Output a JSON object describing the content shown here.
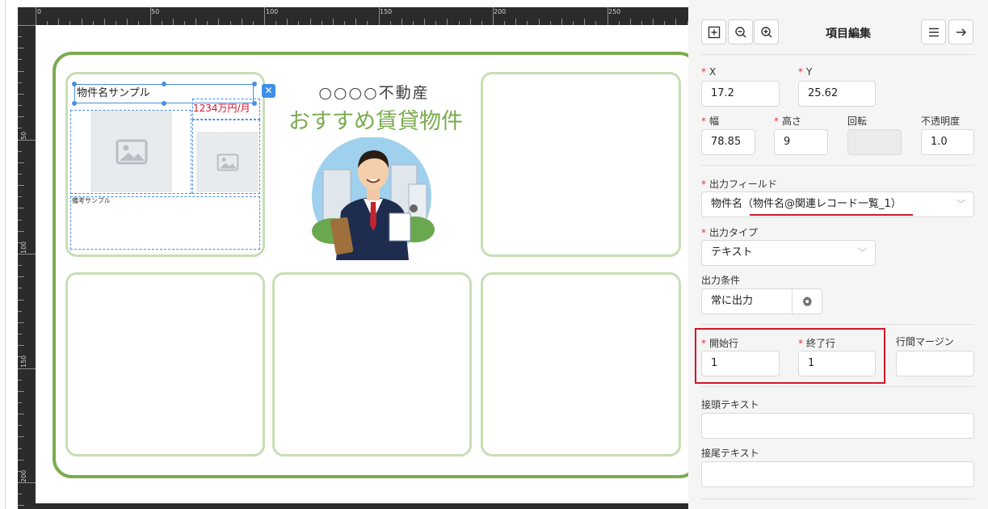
{
  "ruler": {
    "top_labels": [
      "0",
      "50",
      "100",
      "150",
      "200",
      "250"
    ],
    "left_labels": [
      "50",
      "100",
      "150",
      "200"
    ]
  },
  "canvas": {
    "selected_name_text": "物件名サンプル",
    "price_text": "1234万円/月",
    "remarks_text": "備考サンプル",
    "shop_name": "○○○○不動産",
    "heading": "おすすめ賃貸物件",
    "close_icon": "close-icon"
  },
  "panel": {
    "title": "項目編集",
    "icons": {
      "add": "add-frame-icon",
      "zoom_out": "zoom-out-icon",
      "zoom_in": "zoom-in-icon",
      "menu": "menu-icon",
      "forward": "arrow-right-icon",
      "settings": "gear-icon",
      "dropdown": "chevron-down-icon"
    },
    "x": {
      "label": "X",
      "value": "17.2"
    },
    "y": {
      "label": "Y",
      "value": "25.62"
    },
    "width": {
      "label": "幅",
      "value": "78.85"
    },
    "height": {
      "label": "高さ",
      "value": "9"
    },
    "rotation": {
      "label": "回転",
      "value": ""
    },
    "opacity": {
      "label": "不透明度",
      "value": "1.0"
    },
    "output_field": {
      "label": "出力フィールド",
      "value": "物件名（物件名@関連レコード一覧_1）"
    },
    "output_type": {
      "label": "出力タイプ",
      "value": "テキスト"
    },
    "output_condition": {
      "label": "出力条件",
      "value": "常に出力"
    },
    "start_row": {
      "label": "開始行",
      "value": "1"
    },
    "end_row": {
      "label": "終了行",
      "value": "1"
    },
    "line_margin": {
      "label": "行間マージン",
      "value": ""
    },
    "prefix_text": {
      "label": "接頭テキスト",
      "value": ""
    },
    "suffix_text": {
      "label": "接尾テキスト",
      "value": ""
    },
    "highlight_color": "#d0182b",
    "accent_green": "#7aab4f"
  }
}
